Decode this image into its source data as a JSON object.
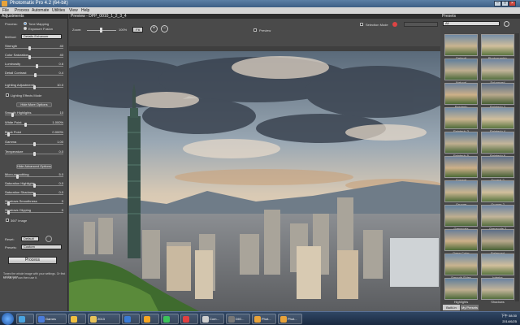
{
  "window": {
    "title": "Photomatix Pro 4.2 (64-bit)"
  },
  "menu": [
    "File",
    "Process",
    "Automate",
    "Utilities",
    "View",
    "Help"
  ],
  "adjustments": {
    "panel_title": "Adjustments",
    "process_label": "Process:",
    "process_options": [
      "Tone Mapping",
      "Exposure Fusion"
    ],
    "method_label": "Method:",
    "method_value": "Details Enhancer",
    "sliders_main": [
      {
        "label": "Strength",
        "value": "40",
        "pos": 0.42
      },
      {
        "label": "Color Saturation",
        "value": "40",
        "pos": 0.42
      },
      {
        "label": "Luminosity",
        "value": "0.6",
        "pos": 0.55
      },
      {
        "label": "Detail Contrast",
        "value": "0.4",
        "pos": 0.52
      }
    ],
    "lighting_label": "Lighting Adjustments",
    "lighting_value": "10.0",
    "lighting_pos": 0.5,
    "lighting_effects_mode": "Lighting Effects Mode",
    "more_options_title": "Hide More Options",
    "sliders_more": [
      {
        "label": "Smooth Highlights",
        "value": "10",
        "pos": 0.12
      },
      {
        "label": "White Point",
        "value": "1.000%",
        "pos": 0.35
      },
      {
        "label": "Black Point",
        "value": "0.000%",
        "pos": 0.05
      },
      {
        "label": "Gamma",
        "value": "1.00",
        "pos": 0.5
      },
      {
        "label": "Temperature",
        "value": "0.0",
        "pos": 0.5
      }
    ],
    "advanced_title": "Hide Advanced Options",
    "sliders_advanced": [
      {
        "label": "Micro-smoothing",
        "value": "5.0",
        "pos": 0.2
      },
      {
        "label": "Saturation Highlights",
        "value": "0.0",
        "pos": 0.5
      },
      {
        "label": "Saturation Shadows",
        "value": "0.0",
        "pos": 0.5
      },
      {
        "label": "Shadows Smoothness",
        "value": "0",
        "pos": 0.05
      },
      {
        "label": "Shadows Clipping",
        "value": "0",
        "pos": 0.05
      }
    ],
    "use_360": "360° image",
    "reset_label": "Reset:",
    "reset_value": "Default",
    "presets_label": "Presets:",
    "presets_value": "Custom",
    "process_button": "Process",
    "tip": "Tones the whole image with your settings. Or first set the tone",
    "tip2": "so that you can then use it."
  },
  "preview": {
    "panel_title": "Preview - DPP_0010_1_2_3_4",
    "zoom_label": "Zoom:",
    "zoom_value": "100%",
    "fit_label": "Fit",
    "preview_button": "Preview",
    "selection_mode": "Selection Mode"
  },
  "presets": {
    "panel_title": "Presets",
    "filter_value": "All",
    "thumbs": [
      "Default",
      "Photographic",
      "Natural",
      "Enhanced",
      "Painterly",
      "Painterly 2",
      "Painterly 3",
      "Painterly 4",
      "Painterly 5",
      "Painterly 6",
      "Surreal",
      "Surreal 2",
      "Grunge",
      "Grunge 2",
      "Greyscale",
      "Greyscale 2",
      "Deep Color",
      "Balanced",
      "Smooth Skies",
      "Interior",
      "Highlights",
      "Shadows"
    ],
    "tab_builtin": "Built-In",
    "tab_mine": "My Presets"
  },
  "taskbar": {
    "items": [
      {
        "label": "",
        "color": "#4aa3df"
      },
      {
        "label": "Games",
        "color": "#4b7bd8"
      },
      {
        "label": "",
        "color": "#f0c040"
      },
      {
        "label": "2013",
        "color": "#e8c35a"
      },
      {
        "label": "",
        "color": "#3a7bd5"
      },
      {
        "label": "",
        "color": "#f6a623"
      },
      {
        "label": "",
        "color": "#3cc35a"
      },
      {
        "label": "",
        "color": "#e04040"
      },
      {
        "label": "Com...",
        "color": "#cfcfcf"
      },
      {
        "label": "DIG...",
        "color": "#777"
      },
      {
        "label": "Phot...",
        "color": "#e8a33a"
      },
      {
        "label": "Phot...",
        "color": "#e8a33a"
      }
    ],
    "time": "下午 08:30",
    "date": "2014/6/25"
  },
  "colors": {
    "accent": "#3d5f86",
    "panel": "#4a4a4a"
  }
}
